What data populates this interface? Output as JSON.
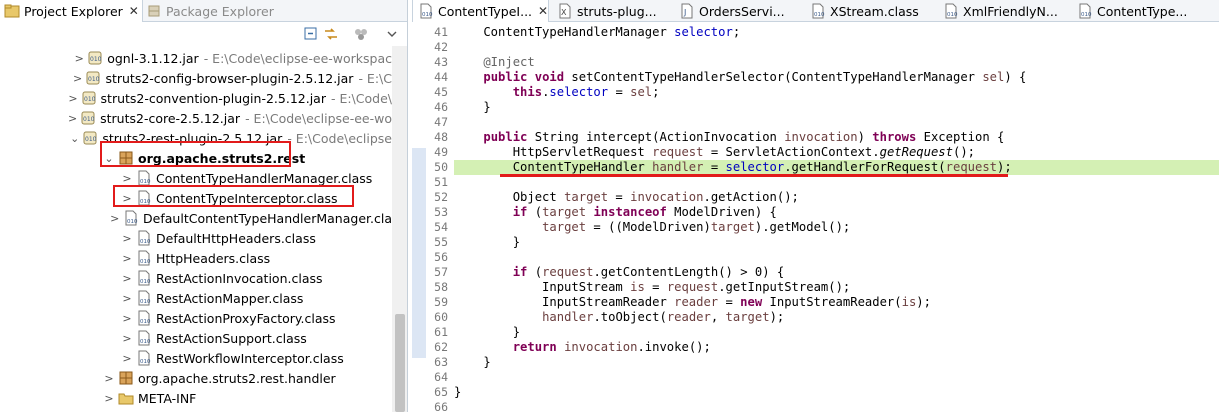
{
  "project_explorer": {
    "tab_active": "Project Explorer",
    "tab_inactive": "Package Explorer",
    "tree": [
      {
        "kind": "jar",
        "label": "ognl-3.1.12.jar",
        "path": "- E:\\Code\\eclipse-ee-workspac"
      },
      {
        "kind": "jar",
        "label": "struts2-config-browser-plugin-2.5.12.jar",
        "path": "- E:\\C"
      },
      {
        "kind": "jar",
        "label": "struts2-convention-plugin-2.5.12.jar",
        "path": "- E:\\Code\\"
      },
      {
        "kind": "jar",
        "label": "struts2-core-2.5.12.jar",
        "path": "- E:\\Code\\eclipse-ee-wo"
      },
      {
        "kind": "jar",
        "label": "struts2-rest-plugin-2.5.12.jar",
        "path": "- E:\\Code\\eclipse"
      },
      {
        "kind": "package",
        "label": "org.apache.struts2.rest"
      },
      {
        "kind": "class",
        "label": "ContentTypeHandlerManager.class"
      },
      {
        "kind": "class",
        "label": "ContentTypeInterceptor.class"
      },
      {
        "kind": "class",
        "label": "DefaultContentTypeHandlerManager.cla"
      },
      {
        "kind": "class",
        "label": "DefaultHttpHeaders.class"
      },
      {
        "kind": "class",
        "label": "HttpHeaders.class"
      },
      {
        "kind": "class",
        "label": "RestActionInvocation.class"
      },
      {
        "kind": "class",
        "label": "RestActionMapper.class"
      },
      {
        "kind": "class",
        "label": "RestActionProxyFactory.class"
      },
      {
        "kind": "class",
        "label": "RestActionSupport.class"
      },
      {
        "kind": "class",
        "label": "RestWorkflowInterceptor.class"
      },
      {
        "kind": "package",
        "label": "org.apache.struts2.rest.handler"
      },
      {
        "kind": "folder",
        "label": "META-INF"
      }
    ]
  },
  "editor": {
    "tabs": [
      "ContentTypeI...",
      "struts-plug...",
      "OrdersServi...",
      "XStream.class",
      "XmlFriendlyN...",
      "ContentType..."
    ],
    "lines": [
      {
        "n": "41",
        "text": "    ContentTypeHandlerManager selector;"
      },
      {
        "n": "42",
        "text": ""
      },
      {
        "n": "43",
        "text": "    @Inject"
      },
      {
        "n": "44",
        "text": "    public void setContentTypeHandlerSelector(ContentTypeHandlerManager sel) {"
      },
      {
        "n": "45",
        "text": "        this.selector = sel;"
      },
      {
        "n": "46",
        "text": "    }"
      },
      {
        "n": "47",
        "text": ""
      },
      {
        "n": "48",
        "text": "    public String intercept(ActionInvocation invocation) throws Exception {"
      },
      {
        "n": "49",
        "text": "        HttpServletRequest request = ServletActionContext.getRequest();"
      },
      {
        "n": "50",
        "text": "        ContentTypeHandler handler = selector.getHandlerForRequest(request);"
      },
      {
        "n": "51",
        "text": ""
      },
      {
        "n": "52",
        "text": "        Object target = invocation.getAction();"
      },
      {
        "n": "53",
        "text": "        if (target instanceof ModelDriven) {"
      },
      {
        "n": "54",
        "text": "            target = ((ModelDriven)target).getModel();"
      },
      {
        "n": "55",
        "text": "        }"
      },
      {
        "n": "56",
        "text": ""
      },
      {
        "n": "57",
        "text": "        if (request.getContentLength() > 0) {"
      },
      {
        "n": "58",
        "text": "            InputStream is = request.getInputStream();"
      },
      {
        "n": "59",
        "text": "            InputStreamReader reader = new InputStreamReader(is);"
      },
      {
        "n": "60",
        "text": "            handler.toObject(reader, target);"
      },
      {
        "n": "61",
        "text": "        }"
      },
      {
        "n": "62",
        "text": "        return invocation.invoke();"
      },
      {
        "n": "63",
        "text": "    }"
      },
      {
        "n": "64",
        "text": ""
      },
      {
        "n": "65",
        "text": "}"
      },
      {
        "n": "66",
        "text": ""
      }
    ]
  },
  "colors": {
    "highlight_line": "#d4f0b4",
    "annotation_red": "#e21b1b",
    "keyword": "#7f0055",
    "field": "#0000c0"
  }
}
